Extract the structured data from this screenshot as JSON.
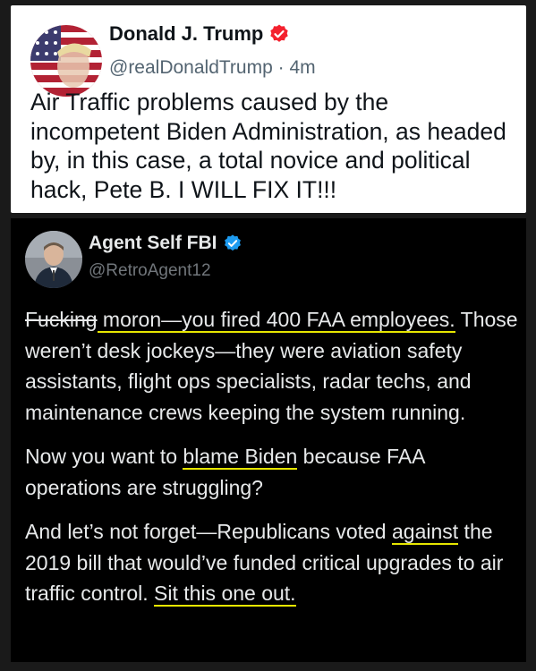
{
  "tweet1": {
    "display_name": "Donald J. Trump",
    "handle": "@realDonaldTrump",
    "separator": " · ",
    "time": "4m",
    "text": "Air Traffic problems caused by the incompetent Biden Administration, as headed by, in this case, a total novice and political hack, Pete B. I WILL FIX IT!!!",
    "badge_color": "#f4212e",
    "verified_icon": "verified-badge-red-icon"
  },
  "tweet2": {
    "display_name": "Agent Self FBI",
    "handle": "@RetroAgent12",
    "badge_color": "#1d9bf0",
    "verified_icon": "verified-badge-blue-icon",
    "para1": {
      "struck": "Fucking",
      "highlight": " moron—you fired 400 FAA employees.",
      "rest": " Those weren’t desk jockeys—they were aviation safety assistants, flight ops specialists, radar techs, and maintenance crews keeping the system running."
    },
    "para2": {
      "before": "Now you want to ",
      "highlight": "blame Biden",
      "after": " because FAA operations are struggling?"
    },
    "para3": {
      "before": "And let’s not forget—Republicans voted ",
      "highlight1": "against",
      "middle": " the 2019 bill that would’ve funded critical upgrades to air traffic control. ",
      "highlight2": "Sit this one out."
    },
    "highlight_color": "#e6e600"
  }
}
